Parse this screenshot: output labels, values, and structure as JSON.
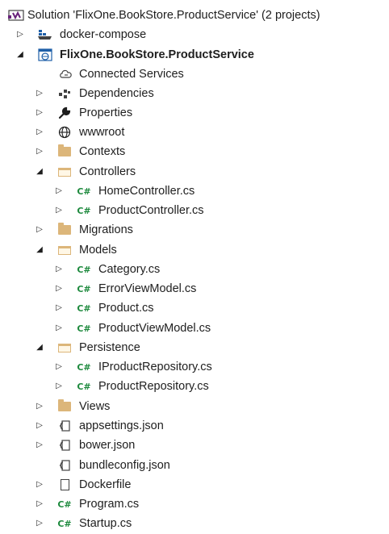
{
  "solution": {
    "label": "Solution 'FlixOne.BookStore.ProductService' (2 projects)",
    "icon": "solution-icon"
  },
  "items": [
    {
      "label": "docker-compose",
      "icon": "docker-compose-icon",
      "expander": "collapsed"
    },
    {
      "label": "FlixOne.BookStore.ProductService",
      "icon": "web-project-icon",
      "expander": "expanded",
      "bold": true
    },
    {
      "label": "Connected Services",
      "icon": "connected-services-icon",
      "expander": "none"
    },
    {
      "label": "Dependencies",
      "icon": "dependencies-icon",
      "expander": "collapsed"
    },
    {
      "label": "Properties",
      "icon": "wrench-icon",
      "expander": "collapsed"
    },
    {
      "label": "wwwroot",
      "icon": "globe-icon",
      "expander": "collapsed"
    },
    {
      "label": "Contexts",
      "icon": "folder-icon",
      "expander": "collapsed"
    },
    {
      "label": "Controllers",
      "icon": "folder-open-icon",
      "expander": "expanded"
    },
    {
      "label": "HomeController.cs",
      "icon": "csharp-file-icon",
      "expander": "collapsed"
    },
    {
      "label": "ProductController.cs",
      "icon": "csharp-file-icon",
      "expander": "collapsed"
    },
    {
      "label": "Migrations",
      "icon": "folder-icon",
      "expander": "collapsed"
    },
    {
      "label": "Models",
      "icon": "folder-open-icon",
      "expander": "expanded"
    },
    {
      "label": "Category.cs",
      "icon": "csharp-file-icon",
      "expander": "collapsed"
    },
    {
      "label": "ErrorViewModel.cs",
      "icon": "csharp-file-icon",
      "expander": "collapsed"
    },
    {
      "label": "Product.cs",
      "icon": "csharp-file-icon",
      "expander": "collapsed"
    },
    {
      "label": "ProductViewModel.cs",
      "icon": "csharp-file-icon",
      "expander": "collapsed"
    },
    {
      "label": "Persistence",
      "icon": "folder-open-icon",
      "expander": "expanded"
    },
    {
      "label": "IProductRepository.cs",
      "icon": "csharp-file-icon",
      "expander": "collapsed"
    },
    {
      "label": "ProductRepository.cs",
      "icon": "csharp-file-icon",
      "expander": "collapsed"
    },
    {
      "label": "Views",
      "icon": "folder-icon",
      "expander": "collapsed"
    },
    {
      "label": "appsettings.json",
      "icon": "json-file-icon",
      "expander": "collapsed"
    },
    {
      "label": "bower.json",
      "icon": "json-file-icon",
      "expander": "collapsed"
    },
    {
      "label": "bundleconfig.json",
      "icon": "json-file-icon",
      "expander": "none"
    },
    {
      "label": "Dockerfile",
      "icon": "file-icon",
      "expander": "collapsed"
    },
    {
      "label": "Program.cs",
      "icon": "csharp-file-icon",
      "expander": "collapsed"
    },
    {
      "label": "Startup.cs",
      "icon": "csharp-file-icon",
      "expander": "collapsed"
    }
  ],
  "glyphs": {
    "csharp": "C#",
    "collapsed": "▷",
    "expanded": "◢"
  },
  "colors": {
    "folder": "#dcb67a",
    "csharp": "#1e8a3e",
    "text": "#1e1e1e"
  }
}
